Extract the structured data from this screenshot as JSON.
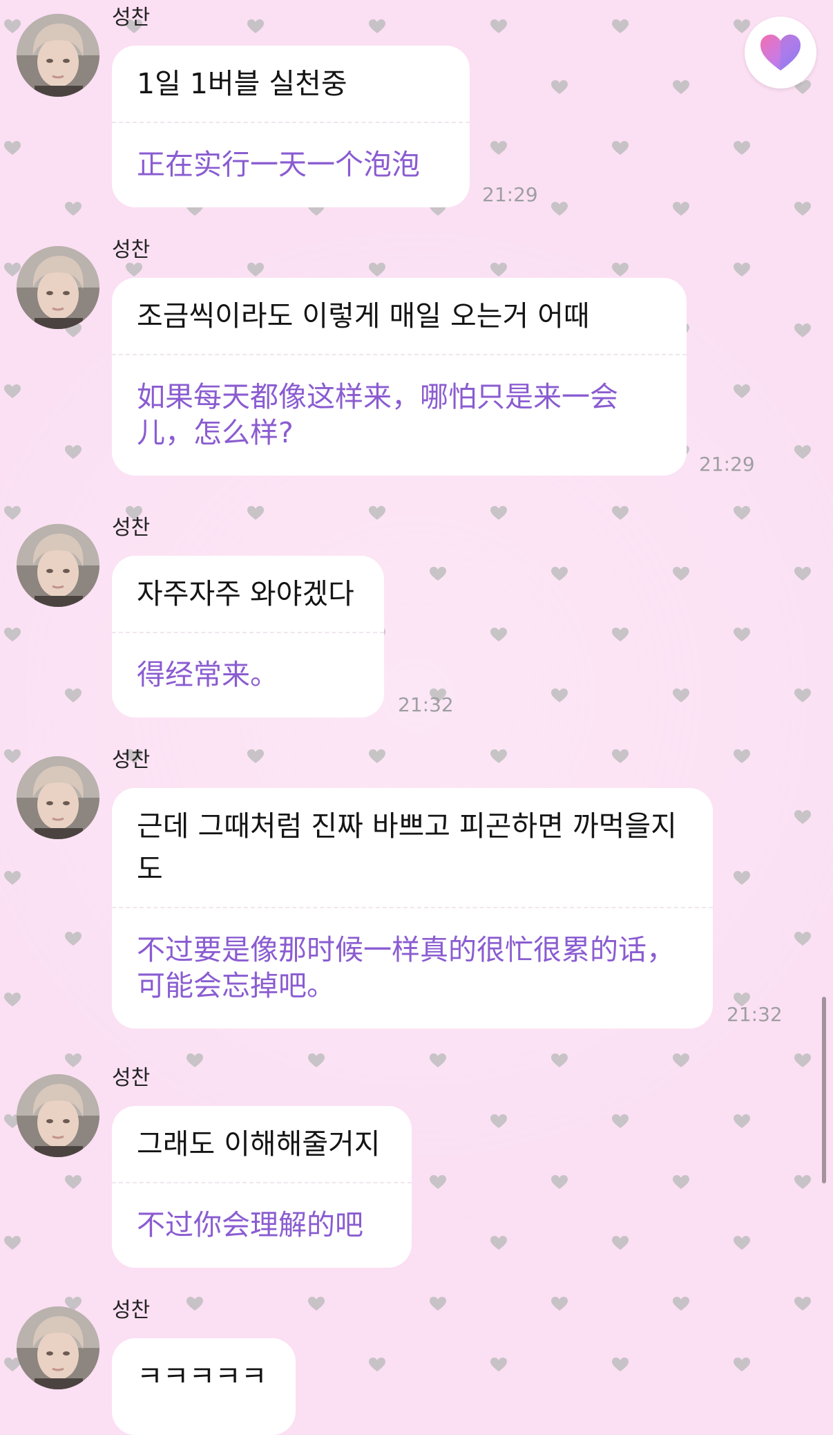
{
  "theme": {
    "background": "#fbdff3",
    "heart_pattern_color": "#bdbdbd",
    "translation_color": "#8a5cd0",
    "time_color": "#9e9ea2"
  },
  "fab": {
    "icon": "heart-gradient-icon"
  },
  "messages": [
    {
      "sender": "성찬",
      "original": "1일 1버블 실천중",
      "translation": "正在实行一天一个泡泡",
      "time": "21:29"
    },
    {
      "sender": "성찬",
      "original": "조금씩이라도 이렇게 매일 오는거 어때",
      "translation": "如果每天都像这样来，哪怕只是来一会儿，怎么样?",
      "time": "21:29"
    },
    {
      "sender": "성찬",
      "original": "자주자주 와야겠다",
      "translation": "得经常来。",
      "time": "21:32"
    },
    {
      "sender": "성찬",
      "original": "근데 그때처럼 진짜 바쁘고 피곤하면 까먹을지도",
      "translation": "不过要是像那时候一样真的很忙很累的话，可能会忘掉吧。",
      "time": "21:32"
    },
    {
      "sender": "성찬",
      "original": "그래도 이해해줄거지",
      "translation": "不过你会理解的吧",
      "time": ""
    },
    {
      "sender": "성찬",
      "original": "ㅋㅋㅋㅋㅋ",
      "translation": "",
      "time": ""
    }
  ]
}
